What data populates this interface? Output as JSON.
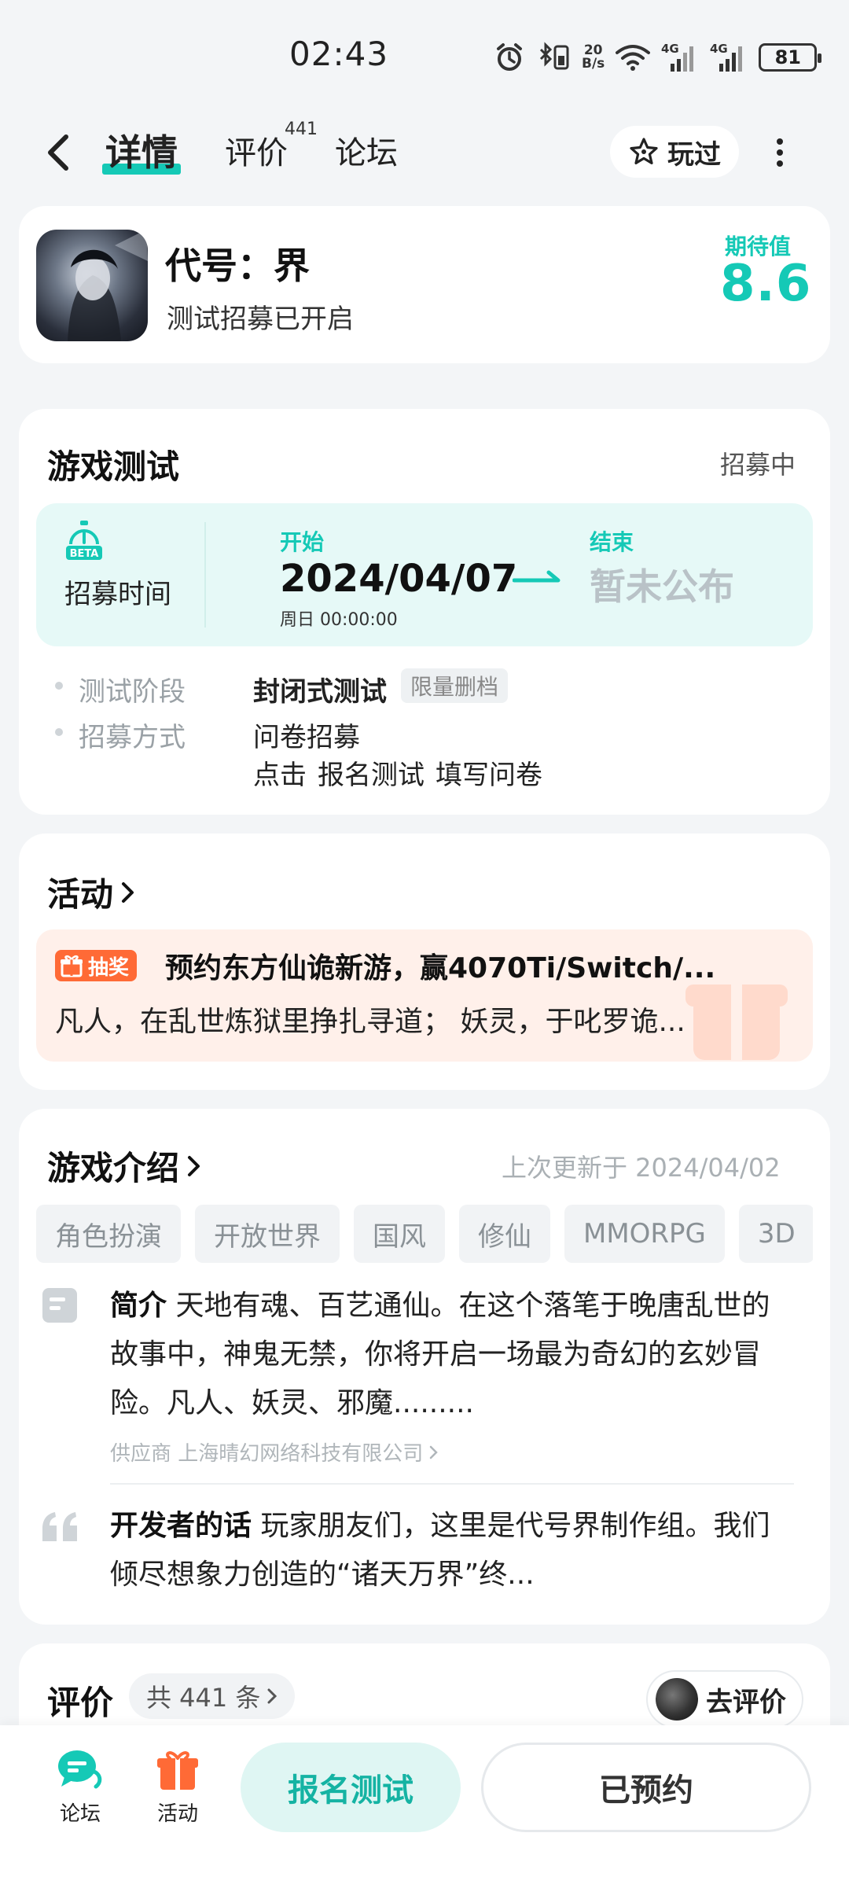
{
  "status_bar": {
    "time": "02:43",
    "net_speed_top": "20",
    "net_speed_bottom": "B/s",
    "net_type_1": "4G",
    "net_type_2": "4G",
    "battery": "81"
  },
  "header": {
    "tabs": [
      {
        "label": "详情",
        "active": true
      },
      {
        "label": "评价",
        "count": "441"
      },
      {
        "label": "论坛"
      }
    ],
    "played_label": "玩过"
  },
  "game": {
    "title": "代号：界",
    "subtitle": "测试招募已开启",
    "expect_label": "期待值",
    "expect_score": "8.6",
    "accent_color": "#15c9b6"
  },
  "test": {
    "title": "游戏测试",
    "status": "招募中",
    "recruit_label": "招募时间",
    "beta_badge": "BETA",
    "start_label": "开始",
    "start_date": "2024/04/07",
    "start_time": "周日  00:00:00",
    "end_label": "结束",
    "end_value": "暂未公布",
    "stage_key": "测试阶段",
    "stage_value": "封闭式测试",
    "stage_tag": "限量删档",
    "method_key": "招募方式",
    "method_value": "问卷招募",
    "method_hint": [
      "点击",
      "报名测试",
      "填写问卷"
    ]
  },
  "activity": {
    "title": "活动",
    "badge": "抽奖",
    "headline": "预约东方仙诡新游，赢4070Ti/Switch/...",
    "description": "凡人，在乱世炼狱里挣扎寻道； 妖灵，于叱罗诡...",
    "badge_color": "#ff6a36"
  },
  "intro": {
    "title": "游戏介绍",
    "updated": "上次更新于 2024/04/02",
    "tags": [
      "角色扮演",
      "开放世界",
      "国风",
      "修仙",
      "MMORPG",
      "3D"
    ],
    "summary_label": "简介",
    "summary_text": "天地有魂、百艺通仙。在这个落笔于晚唐乱世的故事中，神鬼无禁，你将开启一场最为奇幻的玄妙冒险。凡人、妖灵、邪魔.........",
    "supplier": "供应商 上海晴幻网络科技有限公司",
    "dev_label": "开发者的话",
    "dev_text": "玩家朋友们，这里是代号界制作组。我们倾尽想象力创造的“诸天万界”终..."
  },
  "reviews": {
    "title": "评价",
    "count_text": "共 441 条",
    "rate_label": "去评价"
  },
  "bottom_bar": {
    "forum_label": "论坛",
    "activity_label": "活动",
    "signup_label": "报名测试",
    "reserved_label": "已预约"
  }
}
